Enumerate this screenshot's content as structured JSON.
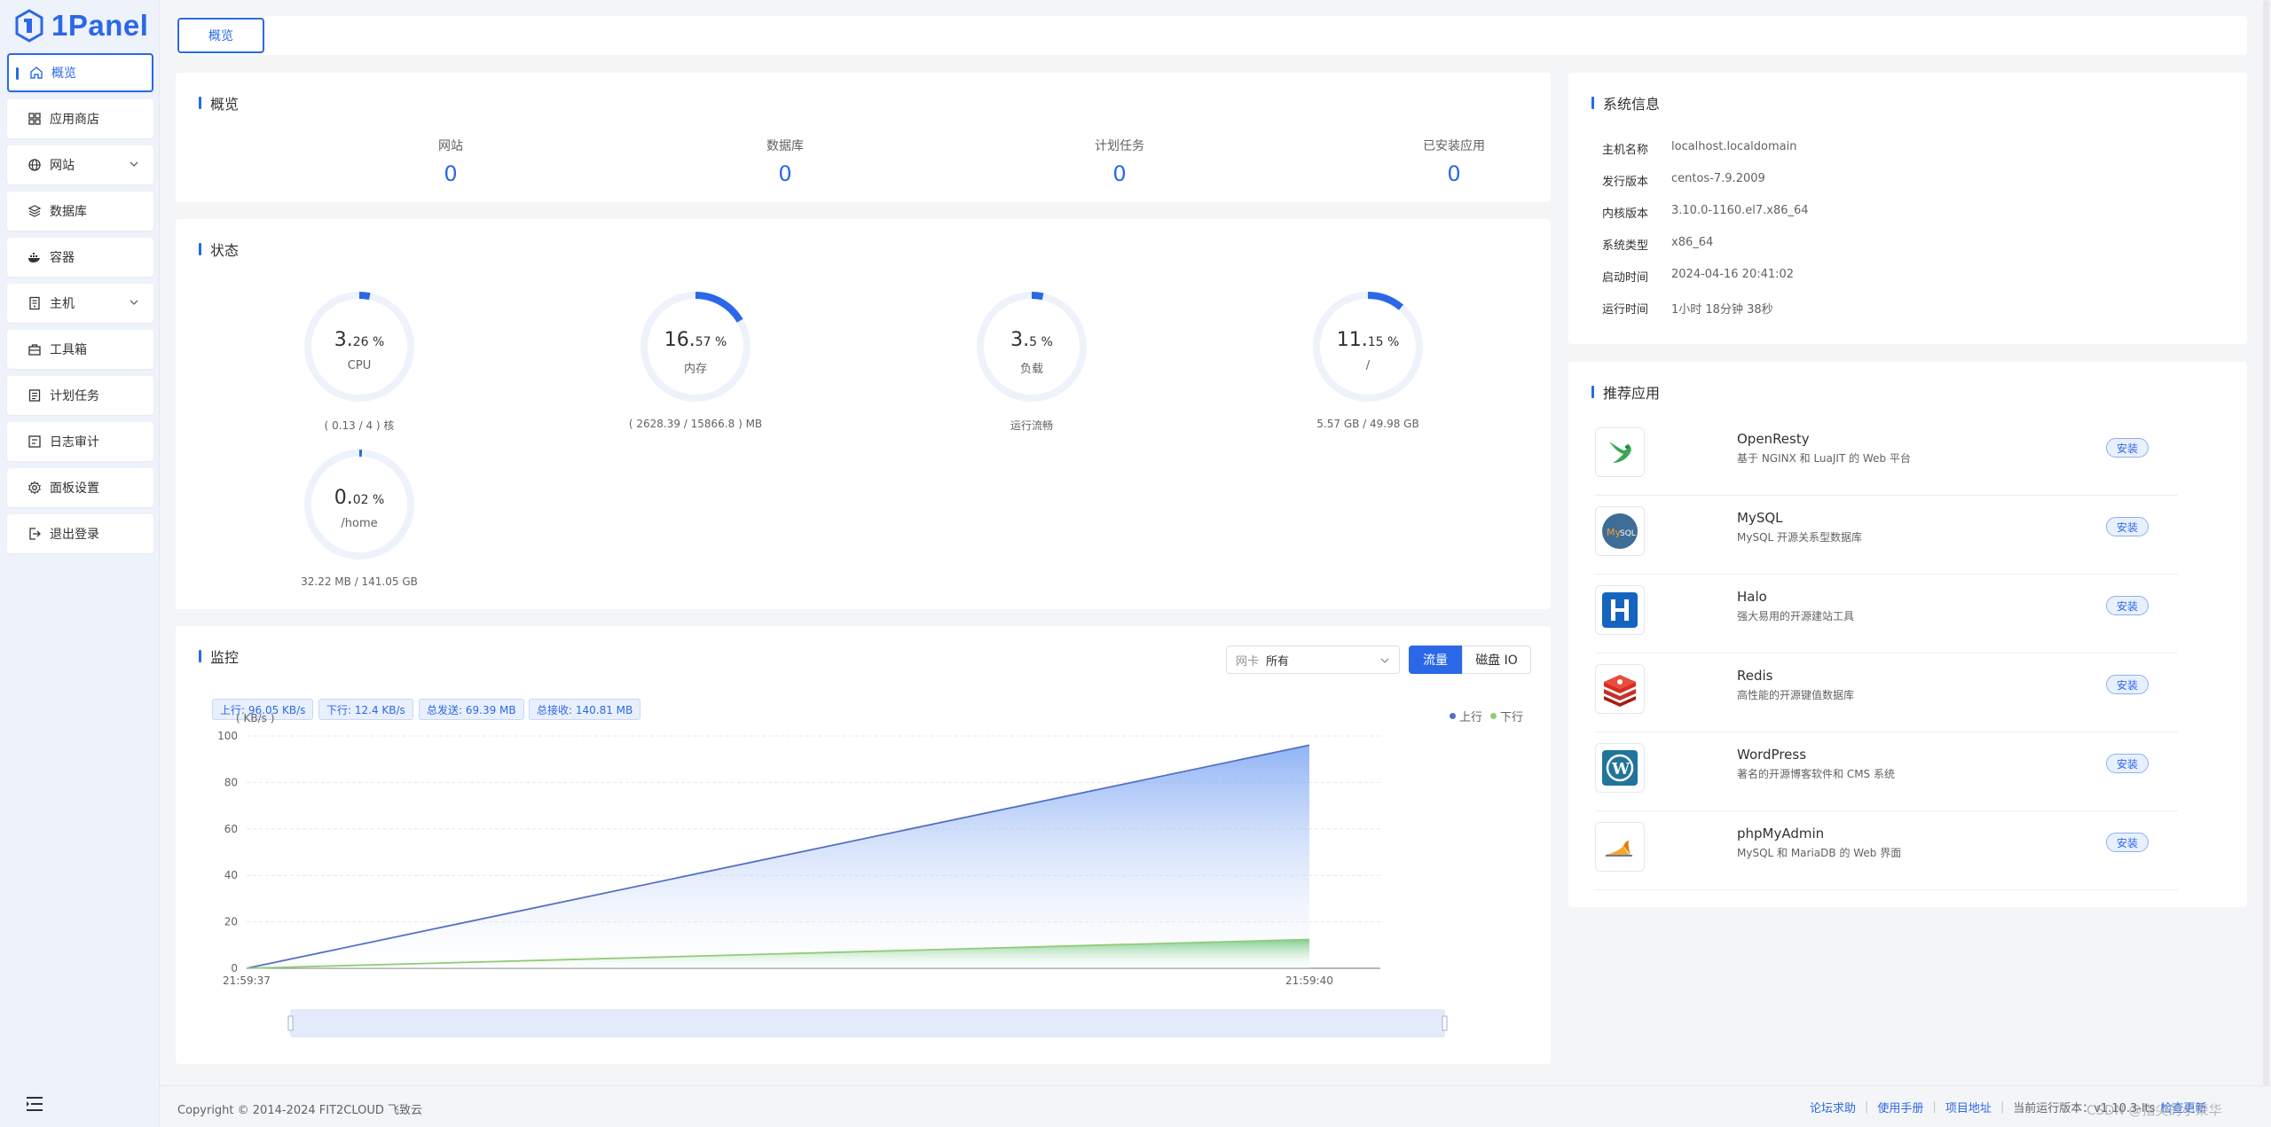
{
  "logo": {
    "text": "1Panel"
  },
  "tabs": [
    {
      "label": "概览"
    }
  ],
  "sidebar": {
    "items": [
      {
        "label": "概览",
        "icon": "home-icon",
        "active": true
      },
      {
        "label": "应用商店",
        "icon": "apps-icon"
      },
      {
        "label": "网站",
        "icon": "globe-icon",
        "has_submenu": true
      },
      {
        "label": "数据库",
        "icon": "database-icon"
      },
      {
        "label": "容器",
        "icon": "docker-icon"
      },
      {
        "label": "主机",
        "icon": "host-icon",
        "has_submenu": true
      },
      {
        "label": "工具箱",
        "icon": "toolbox-icon"
      },
      {
        "label": "计划任务",
        "icon": "task-icon"
      },
      {
        "label": "日志审计",
        "icon": "log-icon"
      },
      {
        "label": "面板设置",
        "icon": "gear-icon"
      },
      {
        "label": "退出登录",
        "icon": "logout-icon"
      }
    ]
  },
  "overview": {
    "title": "概览",
    "items": [
      {
        "label": "网站",
        "value": "0"
      },
      {
        "label": "数据库",
        "value": "0"
      },
      {
        "label": "计划任务",
        "value": "0"
      },
      {
        "label": "已安装应用",
        "value": "0"
      }
    ]
  },
  "status": {
    "title": "状态",
    "gauges": [
      {
        "int": "3.",
        "dec": "26 %",
        "name": "CPU",
        "sub": "( 0.13 / 4 ) 核",
        "percent": 3.26
      },
      {
        "int": "16.",
        "dec": "57 %",
        "name": "内存",
        "sub": "( 2628.39 / 15866.8 ) MB",
        "percent": 16.57
      },
      {
        "int": "3.",
        "dec": "5 %",
        "name": "负载",
        "sub": "运行流畅",
        "percent": 3.5
      },
      {
        "int": "11.",
        "dec": "15 %",
        "name": "/",
        "sub": "5.57 GB / 49.98 GB",
        "percent": 11.15
      },
      {
        "int": "0.",
        "dec": "02 %",
        "name": "/home",
        "sub": "32.22 MB / 141.05 GB",
        "percent": 0.02
      }
    ]
  },
  "monitor": {
    "title": "监控",
    "stats": [
      "上行: 96.05 KB/s",
      "下行: 12.4 KB/s",
      "总发送: 69.39 MB",
      "总接收: 140.81 MB"
    ],
    "nic_prefix": "网卡",
    "nic_value": "所有",
    "btn_flow": "流量",
    "btn_disk": "磁盘 IO",
    "legend": [
      {
        "name": "上行",
        "color": "#5470c6"
      },
      {
        "name": "下行",
        "color": "#91cc75"
      }
    ]
  },
  "chart_data": {
    "type": "area",
    "ylabel": "( KB/s )",
    "ylim": [
      0,
      100
    ],
    "yticks": [
      0,
      20,
      40,
      60,
      80,
      100
    ],
    "x": [
      "21:59:37",
      "21:59:40"
    ],
    "series": [
      {
        "name": "上行",
        "values": [
          0,
          96.05
        ],
        "color": "#5470c6"
      },
      {
        "name": "下行",
        "values": [
          0,
          12.4
        ],
        "color": "#91cc75"
      }
    ],
    "grid": true,
    "legend": "top-right"
  },
  "sysinfo": {
    "title": "系统信息",
    "rows": [
      {
        "k": "主机名称",
        "v": "localhost.localdomain"
      },
      {
        "k": "发行版本",
        "v": "centos-7.9.2009"
      },
      {
        "k": "内核版本",
        "v": "3.10.0-1160.el7.x86_64"
      },
      {
        "k": "系统类型",
        "v": "x86_64"
      },
      {
        "k": "启动时间",
        "v": "2024-04-16 20:41:02"
      },
      {
        "k": "运行时间",
        "v": "1小时 18分钟 38秒"
      }
    ]
  },
  "apps": {
    "title": "推荐应用",
    "install_label": "安装",
    "items": [
      {
        "name": "OpenResty",
        "desc": "基于 NGINX 和 LuaJIT 的 Web 平台",
        "icon": "openresty-icon"
      },
      {
        "name": "MySQL",
        "desc": "MySQL 开源关系型数据库",
        "icon": "mysql-icon"
      },
      {
        "name": "Halo",
        "desc": "强大易用的开源建站工具",
        "icon": "halo-icon"
      },
      {
        "name": "Redis",
        "desc": "高性能的开源键值数据库",
        "icon": "redis-icon"
      },
      {
        "name": "WordPress",
        "desc": "著名的开源博客软件和 CMS 系统",
        "icon": "wordpress-icon"
      },
      {
        "name": "phpMyAdmin",
        "desc": "MySQL 和 MariaDB 的 Web 界面",
        "icon": "phpmyadmin-icon"
      }
    ]
  },
  "footer": {
    "copyright": "Copyright © 2014-2024 FIT2CLOUD 飞致云",
    "links": [
      "论坛求助",
      "使用手册",
      "项目地址"
    ],
    "version": "当前运行版本：v1.10.3-lts",
    "update": "检查更新"
  },
  "watermark": "CSDN @指尖的小荣华"
}
